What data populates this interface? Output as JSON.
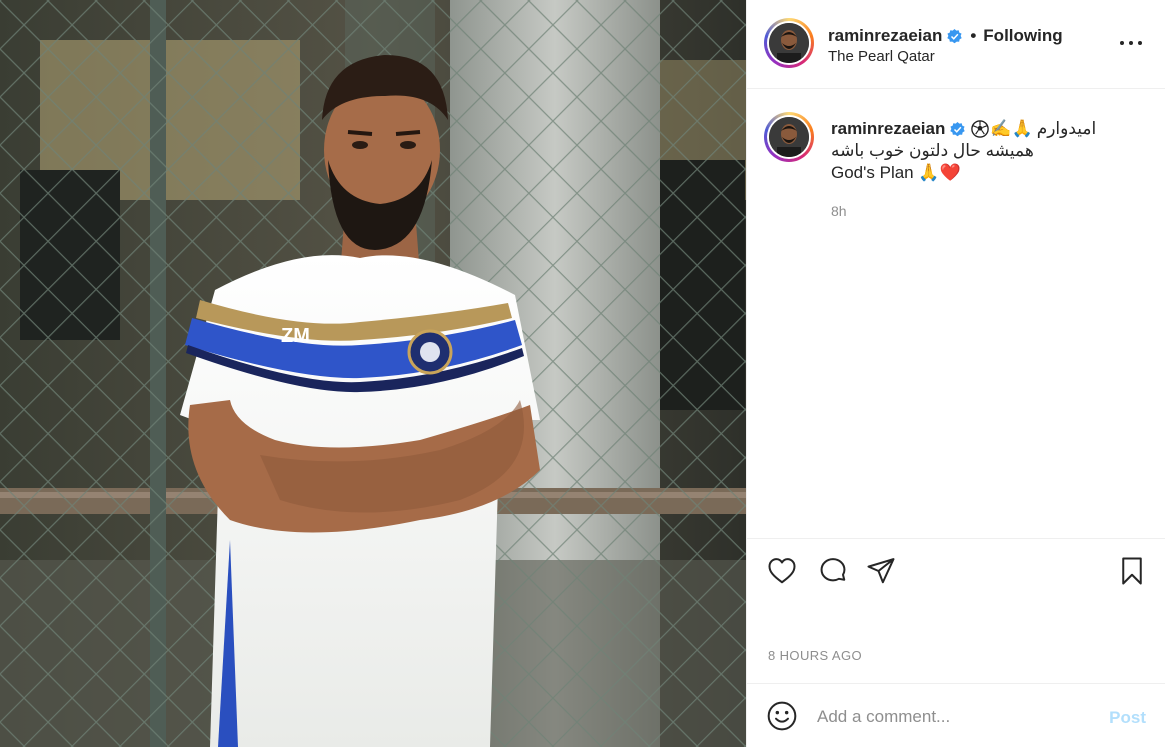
{
  "post": {
    "author": {
      "username": "raminrezaeian",
      "verified": true,
      "follow_state": "Following",
      "location": "The Pearl Qatar"
    },
    "menu_icon": "more-horizontal-icon",
    "caption": {
      "line1_text": "امیدوارم",
      "line1_emojis": "✍️🙏",
      "line2_text": "همیشه حال دلتون خوب باشه",
      "line3_text": "God's Plan",
      "line3_emojis": "🙏❤️",
      "time": "8h"
    },
    "actions": {
      "like_icon": "heart-icon",
      "comment_icon": "comment-icon",
      "share_icon": "paper-plane-icon",
      "save_icon": "bookmark-icon"
    },
    "posted_ago": "8 HOURS AGO",
    "comment_box": {
      "emoji_icon": "smiley-icon",
      "placeholder": "Add a comment...",
      "post_label": "Post"
    }
  },
  "colors": {
    "text": "#262626",
    "muted": "#8e8e8e",
    "verified_blue": "#3897f0",
    "post_disabled": "#b2dffc",
    "divider": "#efefef"
  }
}
